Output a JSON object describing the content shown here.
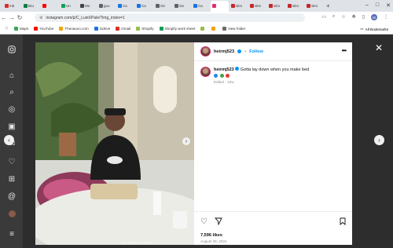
{
  "browser": {
    "tabs": [
      {
        "label": "Inb",
        "color": "#d93025"
      },
      {
        "label": "Bru",
        "color": "#0b8043"
      },
      {
        "label": "",
        "color": "#ff0000"
      },
      {
        "label": "Un",
        "color": "#0f9d58"
      },
      {
        "label": "Mo",
        "color": "#444444"
      },
      {
        "label": "goo",
        "color": "#5f6368"
      },
      {
        "label": "Ca",
        "color": "#1a73e8"
      },
      {
        "label": "Ca",
        "color": "#1a73e8"
      },
      {
        "label": "Ge",
        "color": "#5f6368"
      },
      {
        "label": "Ge",
        "color": "#5f6368"
      },
      {
        "label": "Ca",
        "color": "#1a73e8"
      },
      {
        "label": "",
        "color": "#e1306c"
      },
      {
        "label": "sitrx",
        "color": "#c62828"
      },
      {
        "label": "sitrx",
        "color": "#c62828"
      },
      {
        "label": "sitrx",
        "color": "#c62828"
      },
      {
        "label": "sitrx",
        "color": "#c62828"
      },
      {
        "label": "sitrx",
        "color": "#c62828"
      }
    ],
    "url": "instagram.com/p/C_LuxtXPale/?img_index=1",
    "profile_initial": "M",
    "bookmarks": [
      {
        "label": "Maps",
        "icon": "maps-icon"
      },
      {
        "label": "YouTube",
        "icon": "youtube-icon"
      },
      {
        "label": "Theoauvo.com",
        "icon": "site-icon"
      },
      {
        "label": "Gdrive",
        "icon": "drive-icon"
      },
      {
        "label": "Gmail",
        "icon": "gmail-icon"
      },
      {
        "label": "Shopify",
        "icon": "shopify-icon"
      },
      {
        "label": "Shopify work sheet",
        "icon": "sheet-icon"
      },
      {
        "label": "",
        "icon": "shopify-icon"
      },
      {
        "label": "",
        "icon": "site-icon"
      },
      {
        "label": "New folder",
        "icon": "folder-icon"
      }
    ],
    "all_bookmarks": "All Bookmarks"
  },
  "post": {
    "username": "heirmj523",
    "follow_label": "Follow",
    "caption_user": "heirmj523",
    "caption_text": "Gotta lay down when you make bed",
    "caption_meta": "Edited · 10w",
    "likes": "7,596 likes",
    "date": "August 28, 2024",
    "image_count": 10,
    "current_image": 1
  },
  "colors": {
    "instagram_blue": "#0095f6",
    "backdrop": "#3e3e3e"
  }
}
